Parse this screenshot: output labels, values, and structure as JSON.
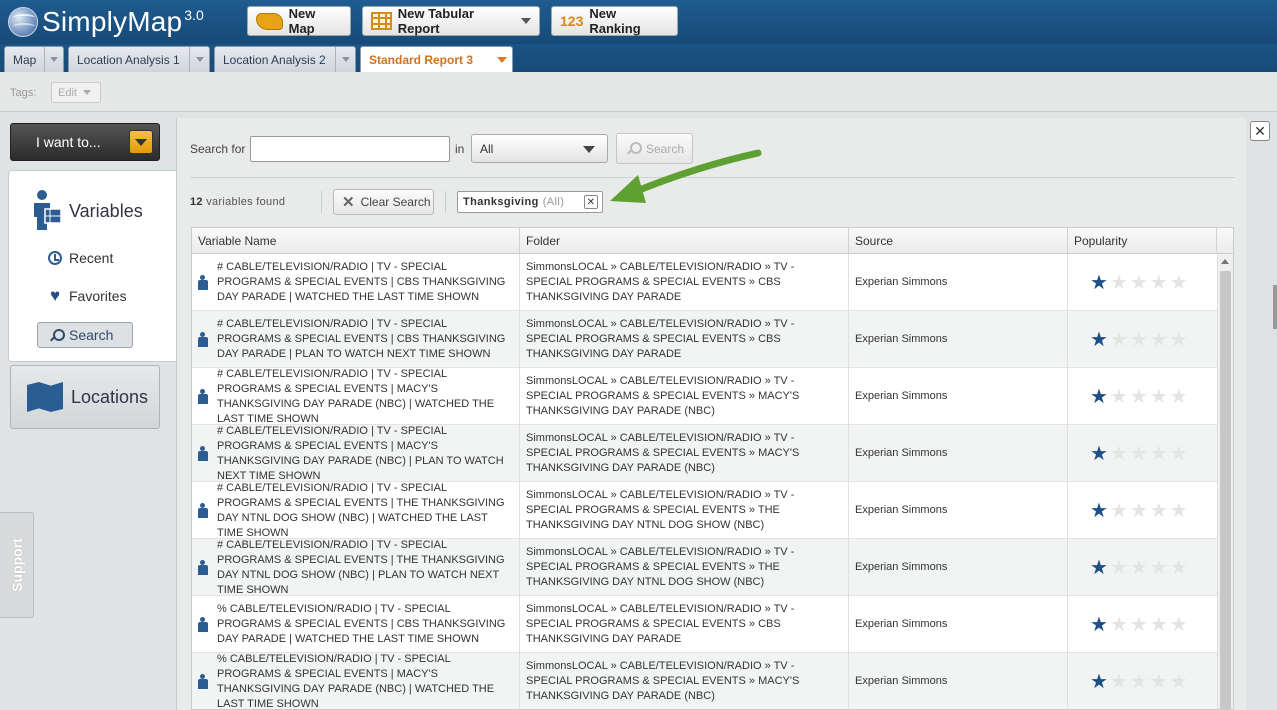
{
  "header": {
    "app_name": "SimplyMap",
    "app_version": "3.0",
    "buttons": [
      {
        "label": "New Map",
        "icon": "us-map-icon"
      },
      {
        "label": "New Tabular Report",
        "icon": "table-grid-icon"
      },
      {
        "label": "New Ranking",
        "icon": "ranking-123-icon",
        "icon_text": "123"
      }
    ]
  },
  "tabs": [
    {
      "label": "Map",
      "active": false
    },
    {
      "label": "Location Analysis 1",
      "active": false
    },
    {
      "label": "Location Analysis 2",
      "active": false
    },
    {
      "label": "Standard Report 3",
      "active": true
    }
  ],
  "tags": {
    "label": "Tags:",
    "edit_label": "Edit"
  },
  "sidebar": {
    "i_want_to": "I want to...",
    "variables_title": "Variables",
    "items": [
      {
        "label": "Recent",
        "icon": "clock-icon"
      },
      {
        "label": "Favorites",
        "icon": "heart-icon"
      },
      {
        "label": "Search",
        "icon": "search-icon",
        "selected": true
      }
    ],
    "locations_title": "Locations",
    "support_label": "Support"
  },
  "search": {
    "search_for_label": "Search for",
    "input_value": "",
    "in_label": "in",
    "scope_value": "All",
    "search_button": "Search",
    "found_count": "12",
    "found_text": "variables found",
    "clear_button": "Clear Search",
    "active_tag": "Thanksgiving",
    "active_tag_scope": "(All)"
  },
  "colors": {
    "accent_orange": "#d0721c",
    "header_blue": "#1f5c90",
    "star_blue": "#1f4f86",
    "arrow_green": "#5fa033"
  },
  "table": {
    "columns": [
      "Variable Name",
      "Folder",
      "Source",
      "Popularity"
    ],
    "rows": [
      {
        "name": "# CABLE/TELEVISION/RADIO | TV - SPECIAL PROGRAMS & SPECIAL EVENTS | CBS THANKSGIVING DAY PARADE | WATCHED THE LAST TIME SHOWN",
        "folder": "SimmonsLOCAL » CABLE/TELEVISION/RADIO » TV - SPECIAL PROGRAMS & SPECIAL EVENTS » CBS THANKSGIVING DAY PARADE",
        "source": "Experian Simmons",
        "popularity": 1
      },
      {
        "name": "# CABLE/TELEVISION/RADIO | TV - SPECIAL PROGRAMS & SPECIAL EVENTS | CBS THANKSGIVING DAY PARADE | PLAN TO WATCH NEXT TIME SHOWN",
        "folder": "SimmonsLOCAL » CABLE/TELEVISION/RADIO » TV - SPECIAL PROGRAMS & SPECIAL EVENTS » CBS THANKSGIVING DAY PARADE",
        "source": "Experian Simmons",
        "popularity": 1
      },
      {
        "name": "# CABLE/TELEVISION/RADIO | TV - SPECIAL PROGRAMS & SPECIAL EVENTS | MACY'S THANKSGIVING DAY PARADE (NBC) | WATCHED THE LAST TIME SHOWN",
        "folder": "SimmonsLOCAL » CABLE/TELEVISION/RADIO » TV - SPECIAL PROGRAMS & SPECIAL EVENTS » MACY'S THANKSGIVING DAY PARADE (NBC)",
        "source": "Experian Simmons",
        "popularity": 1
      },
      {
        "name": "# CABLE/TELEVISION/RADIO | TV - SPECIAL PROGRAMS & SPECIAL EVENTS | MACY'S THANKSGIVING DAY PARADE (NBC) | PLAN TO WATCH NEXT TIME SHOWN",
        "folder": "SimmonsLOCAL » CABLE/TELEVISION/RADIO » TV - SPECIAL PROGRAMS & SPECIAL EVENTS » MACY'S THANKSGIVING DAY PARADE (NBC)",
        "source": "Experian Simmons",
        "popularity": 1
      },
      {
        "name": "# CABLE/TELEVISION/RADIO | TV - SPECIAL PROGRAMS & SPECIAL EVENTS | THE THANKSGIVING DAY NTNL DOG SHOW (NBC) | WATCHED THE LAST TIME SHOWN",
        "folder": "SimmonsLOCAL » CABLE/TELEVISION/RADIO » TV - SPECIAL PROGRAMS & SPECIAL EVENTS » THE THANKSGIVING DAY NTNL DOG SHOW (NBC)",
        "source": "Experian Simmons",
        "popularity": 1
      },
      {
        "name": "# CABLE/TELEVISION/RADIO | TV - SPECIAL PROGRAMS & SPECIAL EVENTS | THE THANKSGIVING DAY NTNL DOG SHOW (NBC) | PLAN TO WATCH NEXT TIME SHOWN",
        "folder": "SimmonsLOCAL » CABLE/TELEVISION/RADIO » TV - SPECIAL PROGRAMS & SPECIAL EVENTS » THE THANKSGIVING DAY NTNL DOG SHOW (NBC)",
        "source": "Experian Simmons",
        "popularity": 1
      },
      {
        "name": "% CABLE/TELEVISION/RADIO | TV - SPECIAL PROGRAMS & SPECIAL EVENTS | CBS THANKSGIVING DAY PARADE | WATCHED THE LAST TIME SHOWN",
        "folder": "SimmonsLOCAL » CABLE/TELEVISION/RADIO » TV - SPECIAL PROGRAMS & SPECIAL EVENTS » CBS THANKSGIVING DAY PARADE",
        "source": "Experian Simmons",
        "popularity": 1
      },
      {
        "name": "% CABLE/TELEVISION/RADIO | TV - SPECIAL PROGRAMS & SPECIAL EVENTS | MACY'S THANKSGIVING DAY PARADE (NBC) | WATCHED THE LAST TIME SHOWN",
        "folder": "SimmonsLOCAL » CABLE/TELEVISION/RADIO » TV - SPECIAL PROGRAMS & SPECIAL EVENTS » MACY'S THANKSGIVING DAY PARADE (NBC)",
        "source": "Experian Simmons",
        "popularity": 1
      }
    ]
  }
}
